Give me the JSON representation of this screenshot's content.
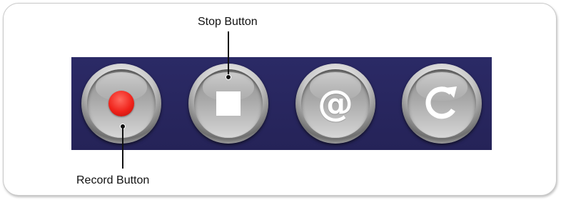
{
  "callouts": {
    "stop_label": "Stop Button",
    "record_label": "Record Button"
  },
  "buttons": [
    {
      "name": "record",
      "icon": "record-dot-icon",
      "color": "#f0231b"
    },
    {
      "name": "stop",
      "icon": "stop-square-icon",
      "color": "#ffffff"
    },
    {
      "name": "email",
      "icon": "at-sign-icon",
      "glyph": "@"
    },
    {
      "name": "refresh",
      "icon": "refresh-icon"
    }
  ],
  "colors": {
    "panel": "#28265f",
    "callout": "#111111"
  }
}
